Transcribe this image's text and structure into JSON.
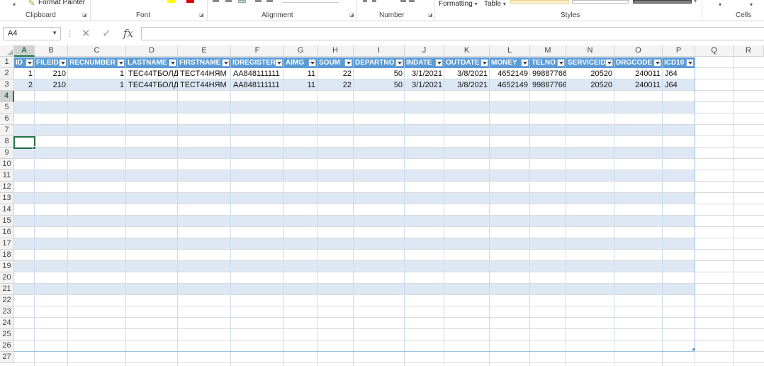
{
  "ribbon": {
    "format_painter": "Format Painter",
    "formatting_label": "Formatting",
    "table_label": "Table",
    "dropdown_glyph": "▾",
    "groups": {
      "clipboard": "Clipboard",
      "font": "Font",
      "alignment": "Alignment",
      "number": "Number",
      "styles": "Styles",
      "cells": "Cells"
    }
  },
  "formula_bar": {
    "name_box": "A4",
    "formula": ""
  },
  "columns": [
    "A",
    "B",
    "C",
    "D",
    "E",
    "F",
    "G",
    "H",
    "I",
    "J",
    "K",
    "L",
    "M",
    "N",
    "O",
    "P",
    "Q",
    "R"
  ],
  "row_numbers": [
    "1",
    "2",
    "3",
    "4",
    "5",
    "6",
    "7",
    "8",
    "9",
    "10",
    "11",
    "12",
    "13",
    "14",
    "15",
    "16",
    "17",
    "18",
    "19",
    "20",
    "21",
    "22",
    "23",
    "24",
    "25",
    "26",
    "27"
  ],
  "table": {
    "headers": [
      "ID",
      "FILEID",
      "RECNUMBER",
      "LASTNAME",
      "FIRSTNAME",
      "IDREGISTER",
      "AIMG",
      "SOUM",
      "DEPARTNO",
      "INDATE",
      "OUTDATE",
      "MONEY",
      "TELNO",
      "SERVICEID",
      "DRGCODE",
      "ICD10"
    ],
    "rows": [
      [
        "1",
        "210",
        "1",
        "ТЕС44ТБОЛД",
        "ТЕСТ44НЯМ",
        "АА848111111",
        "11",
        "22",
        "50",
        "3/1/2021",
        "3/8/2021",
        "4652149",
        "99887766",
        "20520",
        "240011",
        "J64"
      ],
      [
        "2",
        "210",
        "1",
        "ТЕС44ТБОЛД",
        "ТЕСТ44НЯМ",
        "АА848111111",
        "11",
        "22",
        "50",
        "3/1/2021",
        "3/8/2021",
        "4652149",
        "99887766",
        "20520",
        "240011",
        "J64"
      ]
    ]
  },
  "selected_cell": "A4",
  "colors": {
    "excel_green": "#217346",
    "table_header": "#5b9bd5",
    "band_row": "#dde8f4"
  }
}
